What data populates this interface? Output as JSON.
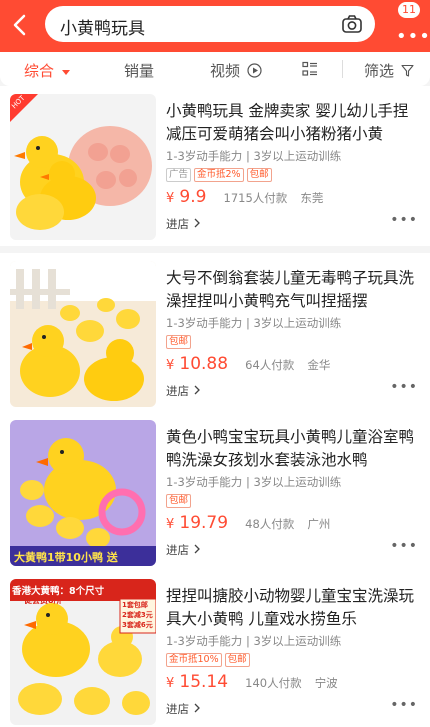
{
  "header": {
    "search_query": "小黄鸭玩具",
    "notification_count": "11",
    "more_dots": "•••"
  },
  "filters": {
    "tabs": [
      {
        "label": "综合",
        "active": true
      },
      {
        "label": "销量"
      },
      {
        "label": "视频"
      },
      {
        "label": "筛选"
      }
    ]
  },
  "products": [
    {
      "title": "小黄鸭玩具 金牌卖家 婴儿幼儿手捏减压可爱萌猪会叫小猪粉猪小黄",
      "attributes": "1-3岁动手能力 | 3岁以上运动训练",
      "tags": [
        "广告",
        "金币抵2%",
        "包邮"
      ],
      "currency": "¥",
      "price": "9.9",
      "sold": "1715人付款",
      "location": "东莞",
      "store_link": "进店",
      "hot_label": "HOT"
    },
    {
      "title": "大号不倒翁套装儿童无毒鸭子玩具洗澡捏捏叫小黄鸭充气叫捏摇摆",
      "attributes": "1-3岁动手能力 | 3岁以上运动训练",
      "tags": [
        "包邮"
      ],
      "currency": "¥",
      "price": "10.88",
      "sold": "64人付款",
      "location": "金华",
      "store_link": "进店"
    },
    {
      "title": "黄色小鸭宝宝玩具小黄鸭儿童浴室鸭鸭洗澡女孩划水套装泳池水鸭",
      "attributes": "1-3岁动手能力 | 3岁以上运动训练",
      "tags": [
        "包邮"
      ],
      "currency": "¥",
      "price": "19.79",
      "sold": "48人付款",
      "location": "广州",
      "store_link": "进店",
      "banner": "大黄鸭1带10小鸭 送"
    },
    {
      "title": "捏捏叫搪胶小动物婴儿童宝宝洗澡玩具大小黄鸭 儿童戏水捞鱼乐",
      "attributes": "1-3岁动手能力 | 3岁以上运动训练",
      "tags": [
        "金币抵10%",
        "包邮"
      ],
      "currency": "¥",
      "price": "15.14",
      "sold": "140人付款",
      "location": "宁波",
      "store_link": "进店",
      "banner_top": "香港大黄鸭：8个尺寸",
      "banner_sub": "促会员8所",
      "promo_lines": [
        "1套包邮",
        "2套减3元",
        "3套减6元"
      ]
    }
  ],
  "colors": {
    "accent": "#ff4b33",
    "duck_yellow": "#ffd21f"
  }
}
